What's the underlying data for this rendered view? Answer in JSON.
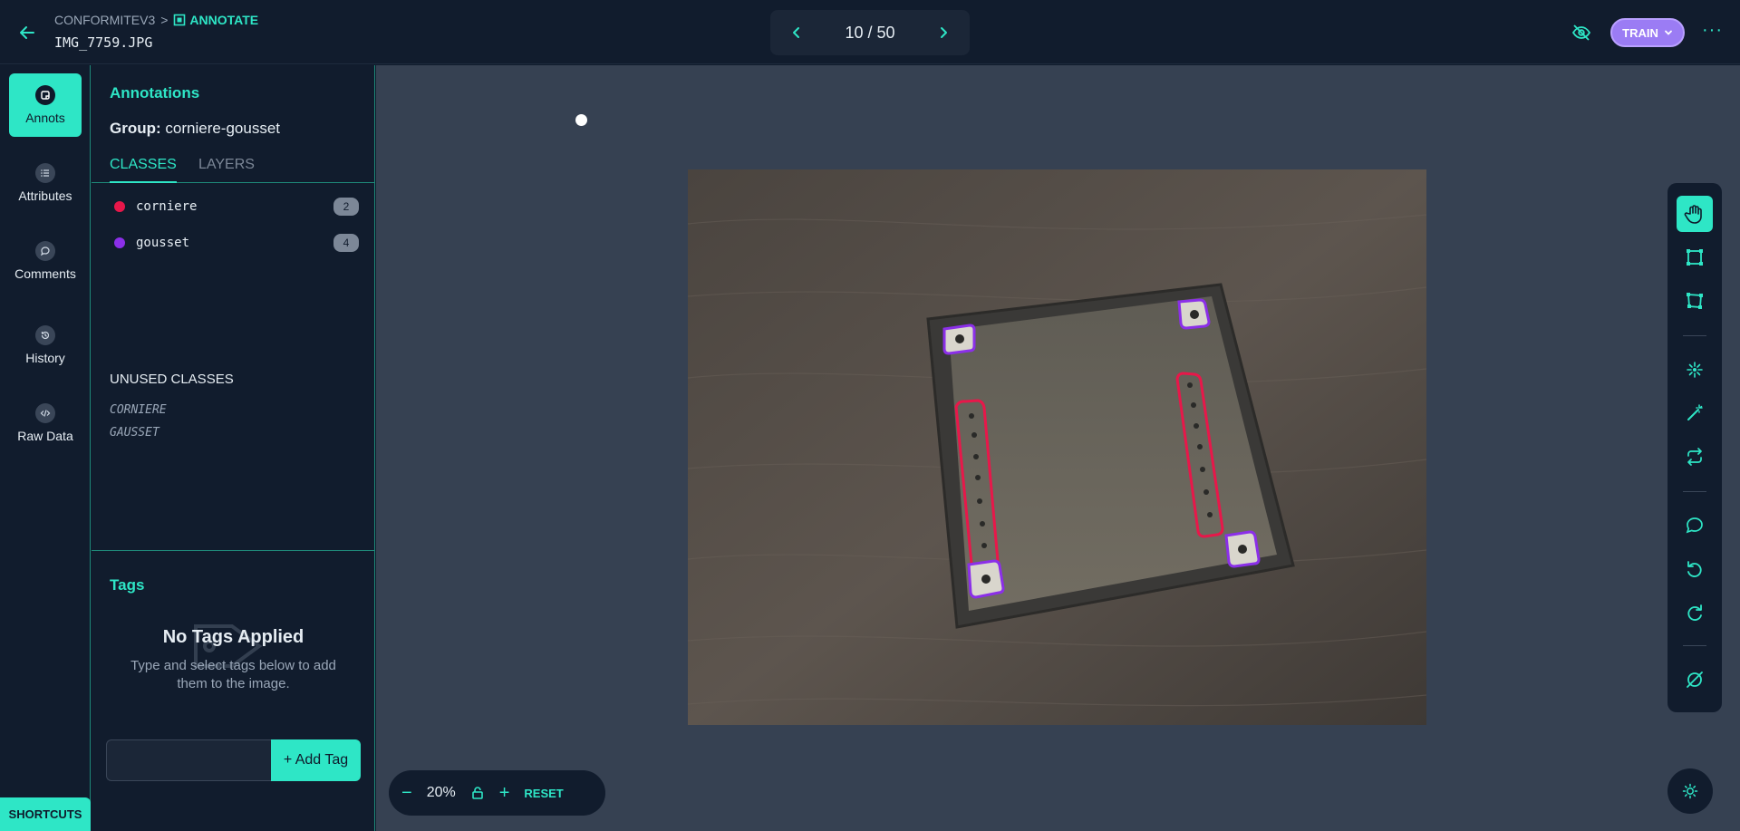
{
  "header": {
    "project": "CONFORMITEV3",
    "separator": ">",
    "mode": "ANNOTATE",
    "filename": "IMG_7759.JPG",
    "pager": "10 / 50",
    "train_label": "TRAIN",
    "more_label": "···"
  },
  "rail": {
    "items": [
      {
        "label": "Annots",
        "icon": "annotation-icon"
      },
      {
        "label": "Attributes",
        "icon": "list-icon"
      },
      {
        "label": "Comments",
        "icon": "comment-icon"
      },
      {
        "label": "History",
        "icon": "history-icon"
      },
      {
        "label": "Raw Data",
        "icon": "code-icon"
      }
    ],
    "shortcuts": "SHORTCUTS"
  },
  "panel": {
    "title": "Annotations",
    "group_label": "Group:",
    "group_value": "corniere-gousset",
    "tabs": [
      "CLASSES",
      "LAYERS"
    ],
    "classes": [
      {
        "name": "corniere",
        "count": "2",
        "color": "#e8174a"
      },
      {
        "name": "gousset",
        "count": "4",
        "color": "#8b2fe8"
      }
    ],
    "unused_title": "UNUSED CLASSES",
    "unused": [
      "CORNIERE",
      "GAUSSET"
    ],
    "tags_title": "Tags",
    "no_tags_title": "No Tags Applied",
    "no_tags_sub": "Type and select tags below to add them to the image.",
    "tag_input_value": "",
    "add_tag_label": "+ Add Tag"
  },
  "zoom": {
    "minus": "−",
    "value": "20%",
    "plus": "+",
    "reset": "RESET"
  },
  "colors": {
    "accent": "#2ee6c6",
    "corniere": "#e8174a",
    "gousset": "#8b2fe8",
    "train": "#9b7cf4"
  }
}
